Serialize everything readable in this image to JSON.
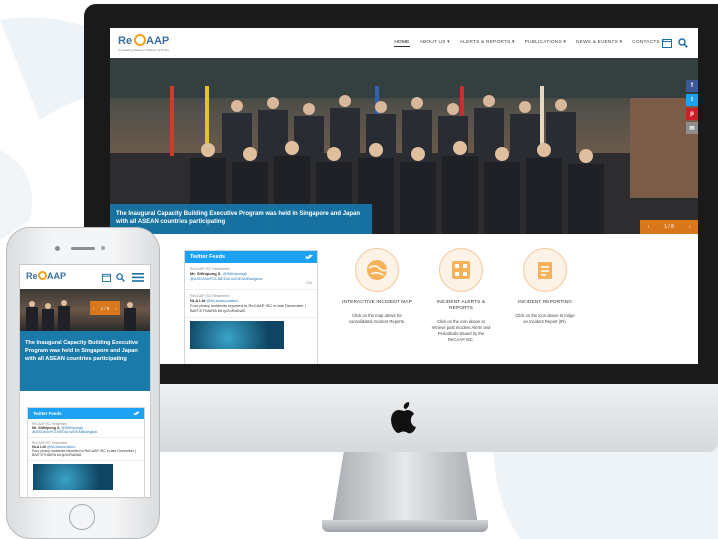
{
  "desktop": {
    "logo": {
      "re": "Re",
      "cap": "AAP",
      "tagline": "Combating Maritime Robbery & Piracy"
    },
    "nav": {
      "items": [
        {
          "label": "HOME",
          "active": true
        },
        {
          "label": "ABOUT US ▾"
        },
        {
          "label": "ALERTS & REPORTS ▾"
        },
        {
          "label": "PUBLICATIONS ▾"
        },
        {
          "label": "NEWS & EVENTS ▾"
        },
        {
          "label": "CONTACTS ▾"
        }
      ]
    },
    "hero": {
      "caption": "The Inaugural Capacity Building Executive Program was held in Singapore and Japan with all ASEAN countries participating",
      "pager": "1 / 8"
    },
    "social": [
      {
        "icon": "facebook-icon",
        "glyph": "f",
        "color": "#3b5998"
      },
      {
        "icon": "twitter-icon",
        "glyph": "t",
        "color": "#1da1f2"
      },
      {
        "icon": "pinterest-icon",
        "glyph": "p",
        "color": "#cb2027"
      },
      {
        "icon": "mail-icon",
        "glyph": "✉",
        "color": "#8e8e8e"
      }
    ],
    "twitter": {
      "title": "Twitter Feeds",
      "tweets": [
        {
          "retweet": "ReCAAP ISC Retweeted",
          "author": "Mr. Sitthipong S.",
          "handle": "@Sitthipong6",
          "text": "@ASEANxPOLMEDIA #ASEANBangkok",
          "time": "21h"
        },
        {
          "retweet": "ReCAAP ISC Retweeted",
          "author": "NLA Ltd",
          "handle": "@NLAassociation",
          "text": "Four piracy incidents reported to ReCAAP ISC in late December | BAIT.ETHAIRA bit.ly/2uRaDw8",
          "time": ""
        }
      ]
    },
    "features": [
      {
        "title": "INTERACTIVE INCIDENT MAP",
        "desc": "Click on the map above for consolidated Incident Reports."
      },
      {
        "title": "INCIDENT ALERTS & REPORTS",
        "desc": "Click on the icon above to retrieve past Incident Alerts and Periodicals issued by the ReCAAP ISC."
      },
      {
        "title": "INCIDENT REPORTING",
        "desc": "Click on the icon above to lodge an Incident Report (IR)."
      }
    ],
    "colors": {
      "accent_blue": "#1678aa",
      "accent_orange": "#d9781a",
      "twitter_blue": "#1da1f2"
    }
  },
  "mobile": {
    "logo": {
      "re": "Re",
      "cap": "AAP"
    },
    "pager": "1 / 8",
    "caption": "The Inaugural Capacity Building Executive Program was held in Singapore and Japan with all ASEAN countries participating",
    "twitter": {
      "title": "Twitter Feeds",
      "tweets": [
        {
          "retweet": "ReCAAP ISC Retweeted",
          "author": "Mr. Sitthipong S.",
          "handle": "@Sitthipong6",
          "text": "@ASEANxPOLMEDIA #ASEANBangkok"
        },
        {
          "retweet": "ReCAAP ISC Retweeted",
          "author": "NLA Ltd",
          "handle": "@NLAassociation",
          "text": "Four piracy incidents reported to ReCAAP ISC in late December | BAIT.ETHAIRA bit.ly/2uRaDw8"
        }
      ]
    }
  }
}
